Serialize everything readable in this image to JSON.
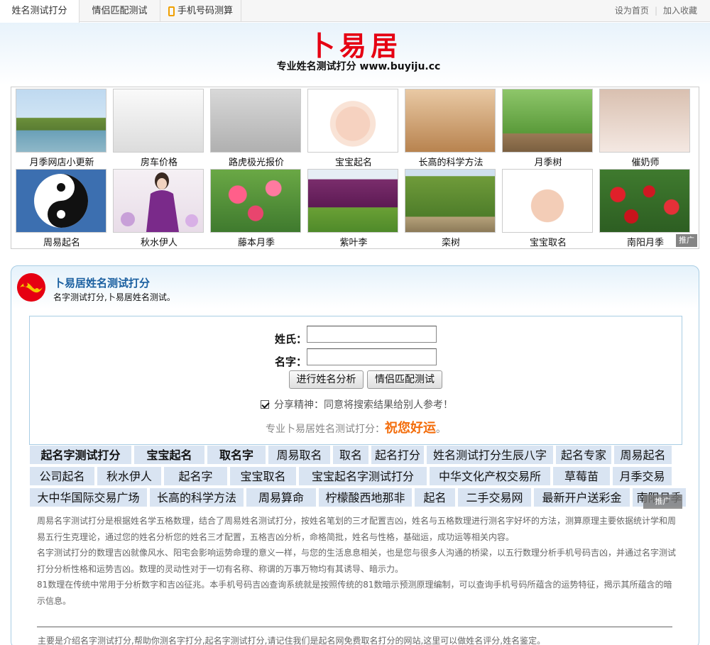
{
  "topbar": {
    "tabs": [
      "姓名测试打分",
      "情侣匹配测试",
      "手机号码测算"
    ],
    "links": [
      "设为首页",
      "加入收藏"
    ],
    "separator": "|"
  },
  "header": {
    "logo": "卜易居",
    "subtitle": "专业姓名测试打分 www.buyiju.cc"
  },
  "grid": {
    "items": [
      {
        "caption": "月季网店小更新",
        "img": "pagoda-lake"
      },
      {
        "caption": "房车价格",
        "img": "motorhome"
      },
      {
        "caption": "路虎极光报价",
        "img": "black-suv"
      },
      {
        "caption": "宝宝起名",
        "img": "baby-pink-hat"
      },
      {
        "caption": "长高的科学方法",
        "img": "tiptoe-feet"
      },
      {
        "caption": "月季树",
        "img": "rose-tree"
      },
      {
        "caption": "催奶师",
        "img": "massage"
      },
      {
        "caption": "周易起名",
        "img": "taiji"
      },
      {
        "caption": "秋水伊人",
        "img": "purple-dress-girl"
      },
      {
        "caption": "藤本月季",
        "img": "climbing-roses"
      },
      {
        "caption": "紫叶李",
        "img": "purple-plum-tree"
      },
      {
        "caption": "栾树",
        "img": "koelreuteria-tree"
      },
      {
        "caption": "宝宝取名",
        "img": "baby-white-hat"
      },
      {
        "caption": "南阳月季",
        "img": "red-roses"
      }
    ],
    "ad_label": "推广"
  },
  "panel": {
    "title": "卜易居姓名测试打分",
    "subtitle": "名字测试打分,卜易居姓名测试。",
    "form": {
      "surname_label": "姓氏：",
      "name_label": "名字：",
      "surname_value": "",
      "name_value": "",
      "analyze_button": "进行姓名分析",
      "match_button": "情侣匹配测试",
      "share_text": "分享精神：同意将搜索结果给别人参考！",
      "share_checked": true,
      "slogan_prefix": "专业卜易居姓名测试打分：",
      "slogan_highlight": "祝您好运",
      "slogan_suffix": "。"
    },
    "link_rows": [
      [
        "起名字测试打分",
        "宝宝起名",
        "取名字",
        "周易取名",
        "取名",
        "起名打分",
        "姓名测试打分生辰八字",
        "起名专家",
        "周易起名"
      ],
      [
        "公司起名",
        "秋水伊人",
        "起名字",
        "宝宝取名",
        "宝宝起名字测试打分",
        "中华文化产权交易所",
        "草莓苗",
        "月季交易"
      ],
      [
        "大中华国际交易广场",
        "长高的科学方法",
        "周易算命",
        "柠檬酸西地那非",
        "起名",
        "二手交易网",
        "最新开户送彩金",
        "南阳月季"
      ]
    ],
    "link_ad_label": "推广",
    "description": [
      "周易名字测试打分是根据姓名学五格数理，结合了周易姓名测试打分，按姓名笔划的三才配置吉凶，姓名与五格数理进行测名字好坏的方法，测算原理主要依据统计学和周易五行生克理论，通过您的姓名分析您的姓名三才配置，五格吉凶分析，命格简批，姓名与性格，基础运，成功运等相关内容。",
      "名字测试打分的数理吉凶就像风水、阳宅会影响运势命理的意义一样，与您的生活息息相关，也是您与很多人沟通的桥梁，以五行数理分析手机号码吉凶，并通过名字测试打分分析性格和运势吉凶。数理的灵动性对于一切有名称、称谓的万事万物均有其诱导、暗示力。",
      "81数理在传统中常用于分析数字和吉凶征兆。本手机号码吉凶查询系统就是按照传统的81数暗示预测原理编制，可以查询手机号码所蕴含的运势特征，揭示其所蕴含的暗示信息。"
    ],
    "footer_text": "主要是介绍名字测试打分,帮助你测名字打分,起名字测试打分,请记住我们是起名网免费取名打分的网站,这里可以做姓名评分,姓名鉴定。"
  },
  "colors": {
    "logo": "#e60012",
    "panel_title": "#1a5fa0",
    "slogan_highlight": "#f36c0a",
    "link_bg": "#d9e4f2",
    "phone_icon": "#f0a000"
  }
}
